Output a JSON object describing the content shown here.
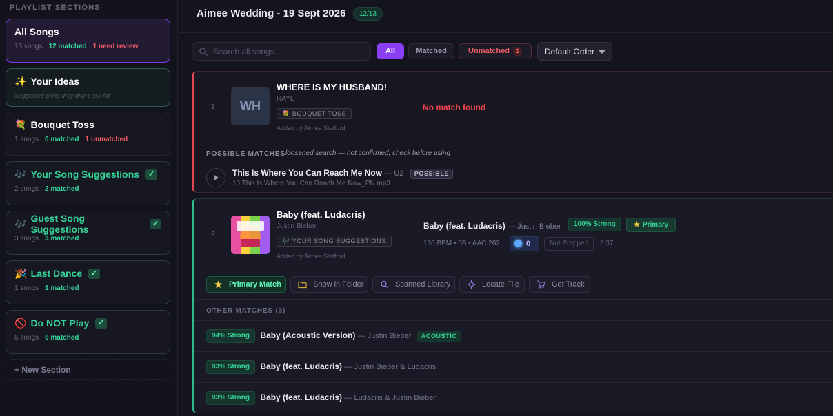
{
  "sidebar": {
    "header": "PLAYLIST SECTIONS",
    "sections": [
      {
        "title": "All Songs",
        "icon": "",
        "songs": "13 songs",
        "matched": "12 matched",
        "extra": "1 need review"
      },
      {
        "title": "Your Ideas",
        "icon": "✨",
        "subtitle": "Suggested picks they didn't ask for"
      },
      {
        "title": "Bouquet Toss",
        "icon": "💐",
        "songs": "1 songs",
        "matched": "0 matched",
        "extra": "1 unmatched"
      },
      {
        "title": "Your Song Suggestions",
        "icon": "🎶",
        "check": "✓",
        "songs": "2 songs",
        "matched": "2 matched"
      },
      {
        "title": "Guest Song Suggestions",
        "icon": "🎶",
        "check": "✓",
        "songs": "3 songs",
        "matched": "3 matched"
      },
      {
        "title": "Last Dance",
        "icon": "🎉",
        "check": "✓",
        "songs": "1 songs",
        "matched": "1 matched"
      },
      {
        "title": "Do NOT Play",
        "icon": "🚫",
        "check": "✓",
        "songs": "6 songs",
        "matched": "6 matched"
      }
    ],
    "new_section": "+ New Section"
  },
  "header": {
    "title": "Aimee Wedding - 19 Sept 2026",
    "count": "12/13"
  },
  "toolbar": {
    "search_placeholder": "Search all songs...",
    "filters": {
      "all": "All",
      "matched": "Matched",
      "unmatched": "Unmatched",
      "unmatched_count": "1"
    },
    "order": "Default Order"
  },
  "songs": [
    {
      "num": "1",
      "initials": "WH",
      "title": "WHERE IS MY HUSBAND!",
      "artist": "RAYE",
      "tag": "💐 BOUQUET TOSS",
      "added_by": "Added by Aimee Stafford",
      "status": "No match found",
      "possible": {
        "header": "POSSIBLE MATCHES",
        "note": "loosened search — not confirmed, check before using",
        "title": "This Is Where You Can Reach Me Now",
        "artist": "— U2",
        "badge": "POSSIBLE",
        "file": "10 This Is Where You Can Reach Me Now_PN.mp3"
      }
    },
    {
      "num": "2",
      "title": "Baby (feat. Ludacris)",
      "artist": "Justin Bieber",
      "tag": "🎶 YOUR SONG SUGGESTIONS",
      "added_by": "Added by Aimee Stafford",
      "match": {
        "title": "Baby (feat. Ludacris)",
        "artist": "— Justin Bieber",
        "strength": "100% Strong",
        "primary": "Primary",
        "meta": "130 BPM • 5B • AAC 262",
        "count": "0",
        "prepped": "Not Prepped",
        "duration": "3:37"
      },
      "actions": [
        "Primary Match",
        "Show in Folder",
        "Scanned Library",
        "Locate File",
        "Get Track"
      ],
      "other_header": "OTHER MATCHES (3)",
      "others": [
        {
          "strength": "94% Strong",
          "title": "Baby (Acoustic Version)",
          "artist": "— Justin Bieber",
          "badge": "ACOUSTIC"
        },
        {
          "strength": "93% Strong",
          "title": "Baby (feat. Ludacris)",
          "artist": "— Justin Bieber & Ludacris"
        },
        {
          "strength": "93% Strong",
          "title": "Baby (feat. Ludacris)",
          "artist": "— Ludacris & Justin Bieber"
        }
      ]
    }
  ],
  "colors": {
    "accent": "#8b3ff4",
    "green": "#34d399",
    "red": "#f0444f"
  }
}
